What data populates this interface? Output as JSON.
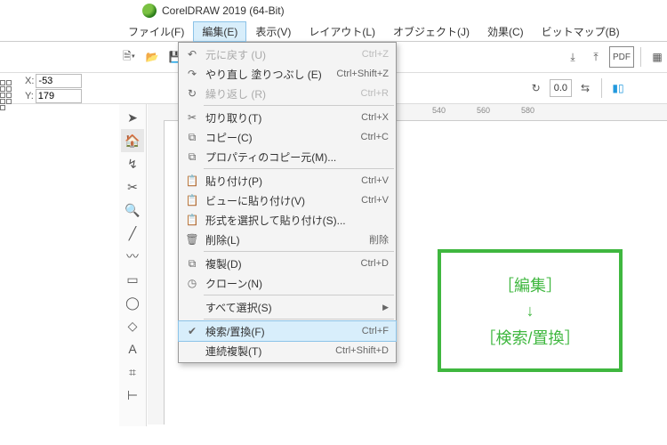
{
  "app_title": "CorelDRAW 2019 (64-Bit)",
  "menu": {
    "file": "ファイル(F)",
    "edit": "編集(E)",
    "view": "表示(V)",
    "layout": "レイアウト(L)",
    "object": "オブジェクト(J)",
    "effect": "効果(C)",
    "bitmap": "ビットマップ(B)"
  },
  "property_bar": {
    "x_label": "X:",
    "y_label": "Y:",
    "x_val": "-53",
    "y_val": "179",
    "rot_label": "0.0"
  },
  "ruler_ticks": [
    "540",
    "560",
    "580"
  ],
  "edit_menu": {
    "undo": {
      "label": "元に戻す (U)",
      "sc": "Ctrl+Z",
      "dis": true
    },
    "redo": {
      "label": "やり直し 塗りつぶし (E)",
      "sc": "Ctrl+Shift+Z"
    },
    "repeat": {
      "label": "繰り返し (R)",
      "sc": "Ctrl+R",
      "dis": true
    },
    "cut": {
      "label": "切り取り(T)",
      "sc": "Ctrl+X"
    },
    "copy": {
      "label": "コピー(C)",
      "sc": "Ctrl+C"
    },
    "copyprop": {
      "label": "プロパティのコピー元(M)..."
    },
    "paste": {
      "label": "貼り付け(P)",
      "sc": "Ctrl+V"
    },
    "pasteview": {
      "label": "ビューに貼り付け(V)",
      "sc": "Ctrl+V"
    },
    "pastespec": {
      "label": "形式を選択して貼り付け(S)..."
    },
    "delete": {
      "label": "削除(L)",
      "sc": "削除"
    },
    "duplicate": {
      "label": "複製(D)",
      "sc": "Ctrl+D"
    },
    "clone": {
      "label": "クローン(N)"
    },
    "selectall": {
      "label": "すべて選択(S)",
      "arrow": true
    },
    "find": {
      "label": "検索/置換(F)",
      "sc": "Ctrl+F",
      "sel": true,
      "check": true
    },
    "stepdup": {
      "label": "連続複製(T)",
      "sc": "Ctrl+Shift+D"
    }
  },
  "callout": {
    "l1": "［編集］",
    "l2": "↓",
    "l3": "［検索/置換］"
  }
}
